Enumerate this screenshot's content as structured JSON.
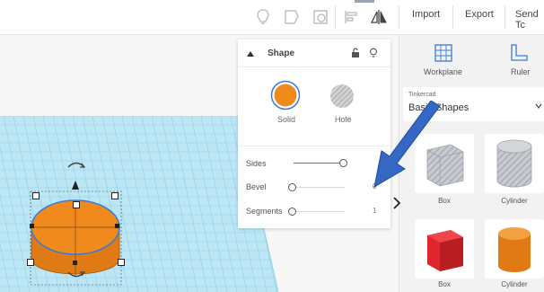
{
  "toolbar": {
    "import_label": "Import",
    "export_label": "Export",
    "send_label": "Send Tc"
  },
  "shape_panel": {
    "title": "Shape",
    "solid_label": "Solid",
    "hole_label": "Hole",
    "properties": [
      {
        "label": "Sides",
        "value": "",
        "fraction": 1.0
      },
      {
        "label": "Bevel",
        "value": "0",
        "fraction": 0.0
      },
      {
        "label": "Segments",
        "value": "1",
        "fraction": 0.0
      }
    ]
  },
  "sidebar": {
    "workplane_label": "Workplane",
    "ruler_label": "Ruler",
    "library_caption": "Tinkercad",
    "library_name": "Basic Shapes",
    "shapes": [
      {
        "label": "Box",
        "color": "#b8bcc4",
        "pattern": "striped"
      },
      {
        "label": "Cylinder",
        "color": "#b8bcc4",
        "pattern": "striped"
      },
      {
        "label": "Box",
        "color": "#e0262c",
        "pattern": "solid"
      },
      {
        "label": "Cylinder",
        "color": "#f08a1c",
        "pattern": "solid"
      }
    ]
  },
  "colors": {
    "grid_blue": "#bde6f5",
    "grid_line": "#8fcfe8",
    "shape_orange": "#f08a1c",
    "arrow_blue": "#3567c4",
    "accent_blue": "#3a7bd5"
  }
}
